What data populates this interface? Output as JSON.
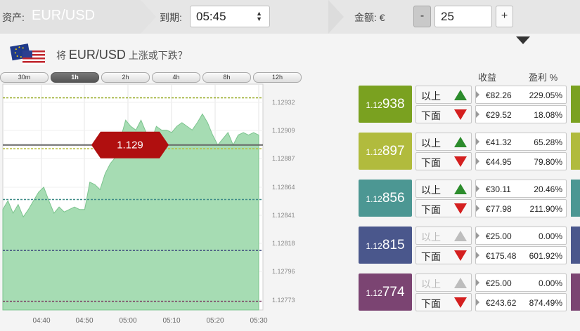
{
  "topbar": {
    "asset_label": "资产:",
    "asset_value": "EUR/USD",
    "expiry_label": "到期:",
    "expiry_value": "05:45",
    "amount_label": "金额: €",
    "minus_label": "-",
    "amount_value": "25",
    "plus_label": "+"
  },
  "question": {
    "prefix": "将",
    "asset": "EUR/USD",
    "suffix": "上涨或下跌？"
  },
  "tabs": [
    {
      "label": "30m"
    },
    {
      "label": "1h"
    },
    {
      "label": "2h"
    },
    {
      "label": "4h"
    },
    {
      "label": "8h"
    },
    {
      "label": "12h"
    }
  ],
  "active_tab": "1h",
  "chart_data": {
    "type": "area",
    "x_ticks": [
      "04:40",
      "04:50",
      "05:00",
      "05:10",
      "05:20",
      "05:30"
    ],
    "y_ticks": [
      "1.12932",
      "1.12909",
      "1.12887",
      "1.12864",
      "1.12841",
      "1.12818",
      "1.12796",
      "1.12773"
    ],
    "current_price_label": "1.129",
    "reference_levels": [
      1.12938,
      1.12897,
      1.12856,
      1.12815,
      1.12774
    ],
    "reference_colors": [
      "#93a81d",
      "#b7be3c",
      "#3f8c88",
      "#3f4c7e",
      "#7a3b62"
    ],
    "current_level": 1.129,
    "ylim": [
      1.12767,
      1.12949
    ],
    "series": [
      {
        "x": [
          0,
          1,
          2,
          3,
          4,
          5,
          6,
          7,
          8,
          9,
          10,
          11,
          12,
          13,
          14,
          15,
          16,
          17,
          18,
          19,
          20,
          21,
          22,
          23,
          24,
          25,
          26,
          27,
          28,
          29,
          30,
          31,
          32,
          33,
          34,
          35,
          36,
          37,
          38,
          39,
          40,
          41,
          42,
          43,
          44,
          45,
          46,
          47,
          48,
          49,
          50
        ],
        "values": [
          1.12848,
          1.12855,
          1.12845,
          1.12852,
          1.12842,
          1.12848,
          1.12855,
          1.12862,
          1.12866,
          1.12855,
          1.12845,
          1.1285,
          1.12846,
          1.12848,
          1.1285,
          1.12848,
          1.12848,
          1.1287,
          1.12868,
          1.12864,
          1.12877,
          1.12885,
          1.1289,
          1.12905,
          1.1292,
          1.12915,
          1.12912,
          1.1292,
          1.1291,
          1.12903,
          1.12915,
          1.12912,
          1.12912,
          1.1291,
          1.12915,
          1.12918,
          1.12915,
          1.12912,
          1.12918,
          1.12925,
          1.12918,
          1.12908,
          1.129,
          1.12905,
          1.1291,
          1.129,
          1.12908,
          1.1291,
          1.12908,
          1.1291,
          1.12908
        ]
      }
    ]
  },
  "table": {
    "col_profit": "收益",
    "col_rate": "盈利 %",
    "up_label": "以上",
    "down_label": "下面",
    "strikes": [
      {
        "prefix": "1.12",
        "suffix": "938",
        "color": "#7aa120",
        "up_enabled": true,
        "up_amount": "€82.26",
        "up_pct": "229.05%",
        "down_amount": "€29.52",
        "down_pct": "18.08%"
      },
      {
        "prefix": "1.12",
        "suffix": "897",
        "color": "#b1bb3d",
        "up_enabled": true,
        "up_amount": "€41.32",
        "up_pct": "65.28%",
        "down_amount": "€44.95",
        "down_pct": "79.80%"
      },
      {
        "prefix": "1.12",
        "suffix": "856",
        "color": "#4c9793",
        "up_enabled": true,
        "up_amount": "€30.11",
        "up_pct": "20.46%",
        "down_amount": "€77.98",
        "down_pct": "211.90%"
      },
      {
        "prefix": "1.12",
        "suffix": "815",
        "color": "#4a578c",
        "up_enabled": false,
        "up_amount": "€25.00",
        "up_pct": "0.00%",
        "down_amount": "€175.48",
        "down_pct": "601.92%"
      },
      {
        "prefix": "1.12",
        "suffix": "774",
        "color": "#7b4472",
        "up_enabled": false,
        "up_amount": "€25.00",
        "up_pct": "0.00%",
        "down_amount": "€243.62",
        "down_pct": "874.49%"
      }
    ]
  }
}
